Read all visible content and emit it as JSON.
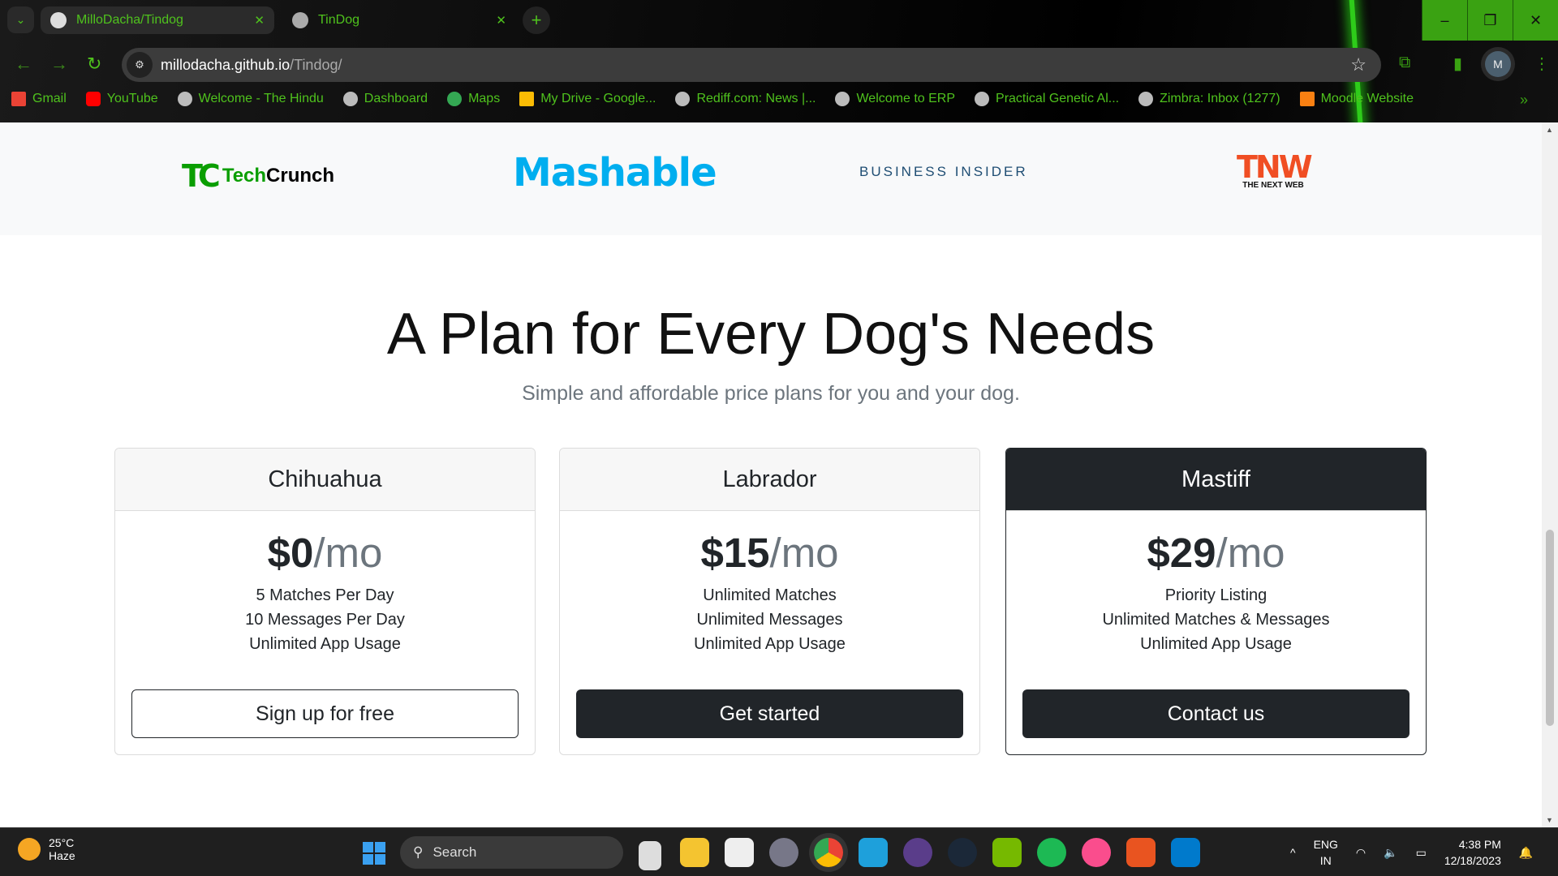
{
  "browser": {
    "tabs": [
      {
        "title": "MilloDacha/Tindog",
        "icon": "github-icon",
        "active": true
      },
      {
        "title": "TinDog",
        "icon": "globe-icon",
        "active": false
      }
    ],
    "url_host": "millodacha.github.io",
    "url_path": "/Tindog/",
    "profile_initial": "M",
    "bookmarks": [
      {
        "label": "Gmail",
        "icon": "gmail-icon"
      },
      {
        "label": "YouTube",
        "icon": "youtube-icon"
      },
      {
        "label": "Welcome - The Hindu",
        "icon": "globe-icon"
      },
      {
        "label": "Dashboard",
        "icon": "globe-icon"
      },
      {
        "label": "Maps",
        "icon": "maps-icon"
      },
      {
        "label": "My Drive - Google...",
        "icon": "drive-icon"
      },
      {
        "label": "Rediff.com: News |...",
        "icon": "globe-icon"
      },
      {
        "label": "Welcome to ERP",
        "icon": "globe-icon"
      },
      {
        "label": "Practical Genetic Al...",
        "icon": "globe-icon"
      },
      {
        "label": "Zimbra: Inbox (1277)",
        "icon": "globe-icon"
      },
      {
        "label": "Moodle Website",
        "icon": "moodle-icon"
      }
    ],
    "accent": "#4fc21d"
  },
  "press": {
    "techcrunch_a": "Tech",
    "techcrunch_b": "Crunch",
    "techcrunch_mark": "TC",
    "mashable": "Mashable",
    "business_insider": "BUSINESS INSIDER",
    "tnw": "TNW",
    "tnw_sub": "THE NEXT WEB"
  },
  "pricing": {
    "title": "A Plan for Every Dog's Needs",
    "subtitle": "Simple and affordable price plans for you and your dog.",
    "plans": [
      {
        "name": "Chihuahua",
        "price": "$0",
        "period": "/mo",
        "features": [
          "5 Matches Per Day",
          "10 Messages Per Day",
          "Unlimited App Usage"
        ],
        "button": "Sign up for free"
      },
      {
        "name": "Labrador",
        "price": "$15",
        "period": "/mo",
        "features": [
          "Unlimited Matches",
          "Unlimited Messages",
          "Unlimited App Usage"
        ],
        "button": "Get started"
      },
      {
        "name": "Mastiff",
        "price": "$29",
        "period": "/mo",
        "features": [
          "Priority Listing",
          "Unlimited Matches & Messages",
          "Unlimited App Usage"
        ],
        "button": "Contact us"
      }
    ]
  },
  "taskbar": {
    "temp": "25°C",
    "weather": "Haze",
    "search": "Search",
    "lang1": "ENG",
    "lang2": "IN",
    "time": "4:38 PM",
    "date": "12/18/2023"
  }
}
